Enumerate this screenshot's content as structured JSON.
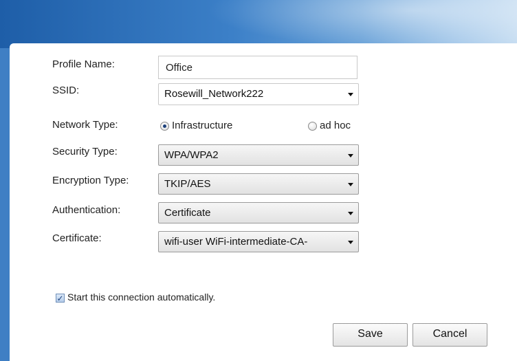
{
  "form": {
    "profile_name": {
      "label": "Profile Name:",
      "value": "Office"
    },
    "ssid": {
      "label": "SSID:",
      "value": "Rosewill_Network222"
    },
    "network_type": {
      "label": "Network Type:",
      "options": [
        {
          "label": "Infrastructure",
          "selected": true
        },
        {
          "label": "ad hoc",
          "selected": false
        }
      ]
    },
    "security_type": {
      "label": "Security Type:",
      "value": "WPA/WPA2"
    },
    "encryption_type": {
      "label": "Encryption Type:",
      "value": "TKIP/AES"
    },
    "authentication": {
      "label": "Authentication:",
      "value": "Certificate"
    },
    "certificate": {
      "label": "Certificate:",
      "value": "wifi-user WiFi-intermediate-CA-"
    },
    "auto_start": {
      "label": "Start this connection automatically.",
      "checked": true,
      "check_glyph": "✓"
    }
  },
  "buttons": {
    "save": "Save",
    "cancel": "Cancel"
  },
  "colors": {
    "banner_start": "#1e5ea8",
    "banner_end": "#c8def2",
    "frame": "#3f7fc4"
  },
  "icons": {
    "dropdown": "chevron-down-icon",
    "radio_selected": "radio-on-icon",
    "radio_unselected": "radio-off-icon",
    "checkbox": "checkbox-checked-icon"
  }
}
